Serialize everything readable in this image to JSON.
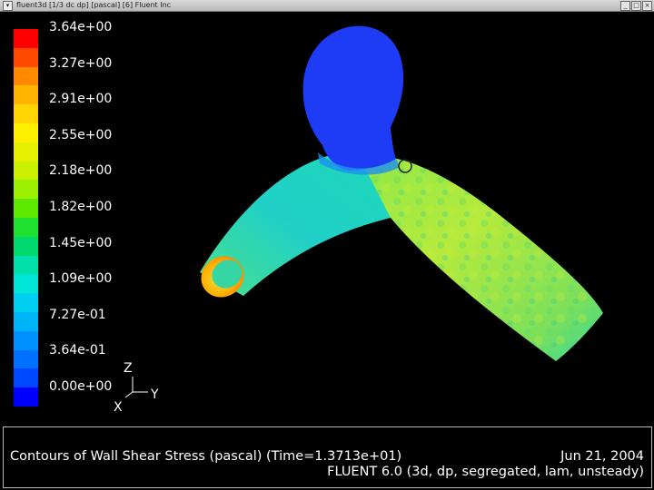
{
  "window": {
    "title": "fluent3d [1/3 dc dp] [pascal] [6] Fluent Inc",
    "buttons": [
      "_",
      "□",
      "×"
    ]
  },
  "legend": {
    "labels": [
      "3.64e+00",
      "3.27e+00",
      "2.91e+00",
      "2.55e+00",
      "2.18e+00",
      "1.82e+00",
      "1.45e+00",
      "1.09e+00",
      "7.27e-01",
      "3.64e-01",
      "0.00e+00"
    ],
    "colors": [
      "#ff0000",
      "#ff4a00",
      "#ff8a00",
      "#ffb400",
      "#ffd400",
      "#fff000",
      "#e6f000",
      "#c8f000",
      "#9af000",
      "#5ee800",
      "#20e030",
      "#00d870",
      "#00e0a8",
      "#00e6d6",
      "#00d0f0",
      "#00b4f8",
      "#0090ff",
      "#0070ff",
      "#0048ff",
      "#0000ff"
    ]
  },
  "axes": {
    "z": "Z",
    "y": "Y",
    "x": "X"
  },
  "caption": {
    "title": "Contours of Wall Shear Stress (pascal)  (Time=1.3713e+01)",
    "date": "Jun 21, 2004",
    "solver": "FLUENT 6.0 (3d, dp, segregated, lam, unsteady)"
  }
}
